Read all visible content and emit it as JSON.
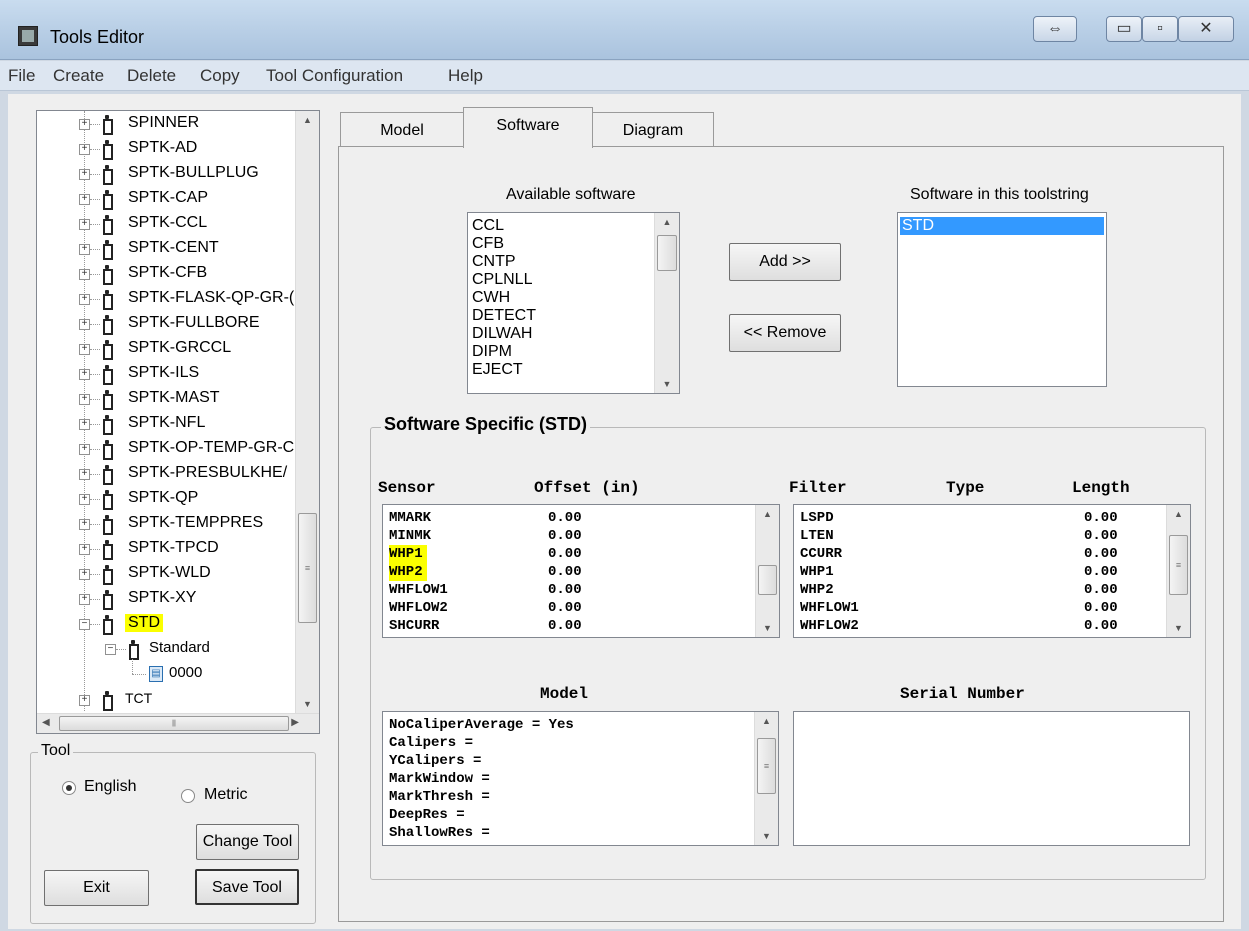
{
  "window": {
    "title": "Tools Editor",
    "snap_glyph": "⇔",
    "min_glyph": "▭",
    "max_glyph": "▫",
    "close_glyph": "✕"
  },
  "menu": [
    "File",
    "Create",
    "Delete",
    "Copy",
    "Tool Configuration",
    "Help"
  ],
  "tree": {
    "items": [
      "SPINNER",
      "SPTK-AD",
      "SPTK-BULLPLUG",
      "SPTK-CAP",
      "SPTK-CCL",
      "SPTK-CENT",
      "SPTK-CFB",
      "SPTK-FLASK-QP-GR-(",
      "SPTK-FULLBORE",
      "SPTK-GRCCL",
      "SPTK-ILS",
      "SPTK-MAST",
      "SPTK-NFL",
      "SPTK-OP-TEMP-GR-C",
      "SPTK-PRESBULKHE/",
      "SPTK-QP",
      "SPTK-TEMPPRES",
      "SPTK-TPCD",
      "SPTK-WLD",
      "SPTK-XY"
    ],
    "selected": "STD",
    "child": "Standard",
    "grandchild": "0000",
    "partial_next": "TCT"
  },
  "tool_group": {
    "legend": "Tool",
    "english": "English",
    "metric": "Metric",
    "change_tool": "Change Tool",
    "exit": "Exit",
    "save_tool": "Save Tool"
  },
  "tabs": [
    "Model",
    "Software",
    "Diagram"
  ],
  "software": {
    "available_label": "Available software",
    "available": [
      "CCL",
      "CFB",
      "CNTP",
      "CPLNLL",
      "CWH",
      "DETECT",
      "DILWAH",
      "DIPM",
      "EJECT"
    ],
    "in_toolstring_label": "Software in this toolstring",
    "in_toolstring": [
      "STD"
    ],
    "add": "Add >>",
    "remove": "<< Remove"
  },
  "specific": {
    "legend": "Software Specific (STD)",
    "sensor_header": "Sensor",
    "offset_header": "Offset (in)",
    "sensors": [
      {
        "name": "MMARK",
        "offset": "0.00",
        "highlight": false
      },
      {
        "name": "MINMK",
        "offset": "0.00",
        "highlight": false
      },
      {
        "name": "WHP1",
        "offset": "0.00",
        "highlight": true
      },
      {
        "name": "WHP2",
        "offset": "0.00",
        "highlight": true
      },
      {
        "name": "WHFLOW1",
        "offset": "0.00",
        "highlight": false
      },
      {
        "name": "WHFLOW2",
        "offset": "0.00",
        "highlight": false
      },
      {
        "name": "SHCURR",
        "offset": "0.00",
        "highlight": false
      }
    ],
    "filter_header": "Filter",
    "type_header": "Type",
    "length_header": "Length",
    "filters": [
      {
        "name": "LSPD",
        "length": "0.00"
      },
      {
        "name": "LTEN",
        "length": "0.00"
      },
      {
        "name": "CCURR",
        "length": "0.00"
      },
      {
        "name": "WHP1",
        "length": "0.00"
      },
      {
        "name": "WHP2",
        "length": "0.00"
      },
      {
        "name": "WHFLOW1",
        "length": "0.00"
      },
      {
        "name": "WHFLOW2",
        "length": "0.00"
      }
    ],
    "model_header": "Model",
    "serial_header": "Serial Number",
    "model_lines": [
      "NoCaliperAverage = Yes",
      "Calipers =",
      "YCalipers =",
      "MarkWindow =",
      "MarkThresh =",
      "DeepRes =",
      "ShallowRes ="
    ]
  }
}
